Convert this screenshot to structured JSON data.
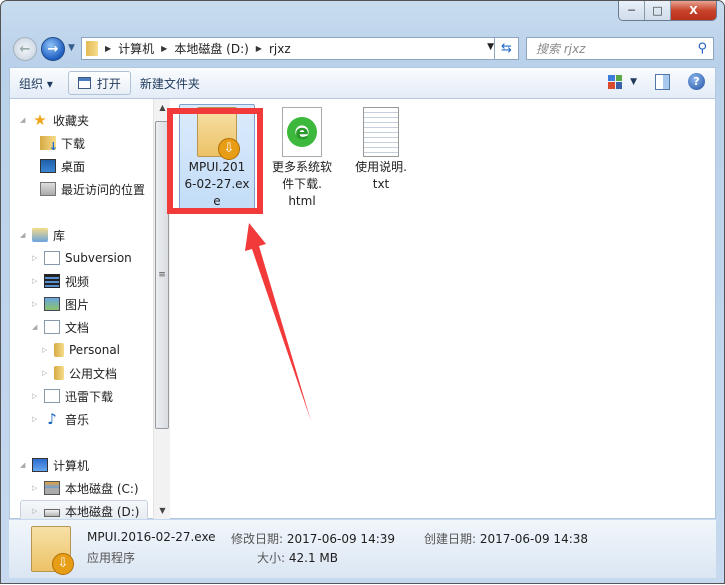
{
  "window": {
    "minimize": "─",
    "maximize": "□",
    "close": "X"
  },
  "address": {
    "crumbs": [
      "计算机",
      "本地磁盘 (D:)",
      "rjxz"
    ]
  },
  "search": {
    "placeholder": "搜索 rjxz"
  },
  "toolbar": {
    "organize": "组织 ▾",
    "open": "打开",
    "new_folder": "新建文件夹"
  },
  "nav": {
    "favorites": {
      "label": "收藏夹",
      "items": [
        "下载",
        "桌面",
        "最近访问的位置"
      ]
    },
    "libraries": {
      "label": "库",
      "items": [
        "Subversion",
        "视频",
        "图片",
        "文档",
        "Personal",
        "公用文档",
        "迅雷下载",
        "音乐"
      ]
    },
    "computer": {
      "label": "计算机",
      "items": [
        "本地磁盘 (C:)",
        "本地磁盘 (D:)"
      ]
    }
  },
  "files": [
    {
      "name": "MPUI.2016-02-27.exe",
      "lines": [
        "MPUI.201",
        "6-02-27.ex",
        "e"
      ],
      "icon": "installer-icon",
      "selected": true
    },
    {
      "name": "更多系统软件下载.html",
      "lines": [
        "更多系统软",
        "件下载.",
        "html"
      ],
      "icon": "ie-html-icon"
    },
    {
      "name": "使用说明.txt",
      "lines": [
        "使用说明.",
        "txt"
      ],
      "icon": "text-file-icon"
    }
  ],
  "status": {
    "filename": "MPUI.2016-02-27.exe",
    "type": "应用程序",
    "modified_label": "修改日期:",
    "modified": "2017-06-09 14:39",
    "created_label": "创建日期:",
    "created": "2017-06-09 14:38",
    "size_label": "大小:",
    "size": "42.1 MB"
  },
  "annotation": {
    "color": "#f23a3a"
  }
}
